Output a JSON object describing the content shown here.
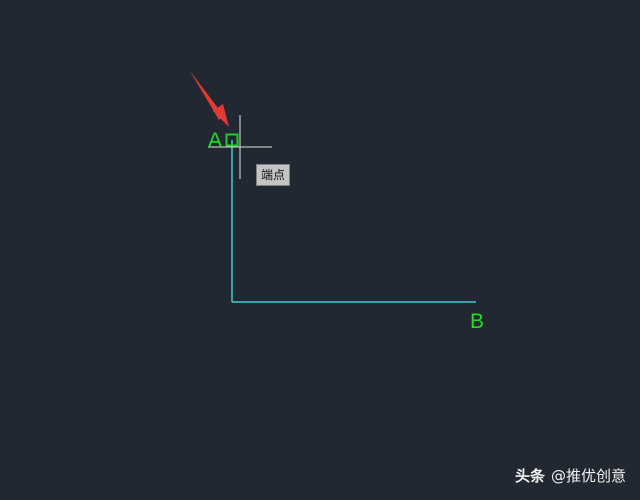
{
  "canvas": {
    "background_color": "#222831"
  },
  "drawing": {
    "line_color": "#3fc8d4",
    "crosshair_color": "#e0e0e0",
    "snap_marker_color": "#22cc22",
    "arrow_color": "#e53935"
  },
  "labels": {
    "point_a": "A",
    "point_b": "B",
    "label_color": "#1ee01e"
  },
  "tooltip": {
    "text": "端点"
  },
  "watermark": {
    "brand": "头条",
    "handle": "@推优创意"
  }
}
